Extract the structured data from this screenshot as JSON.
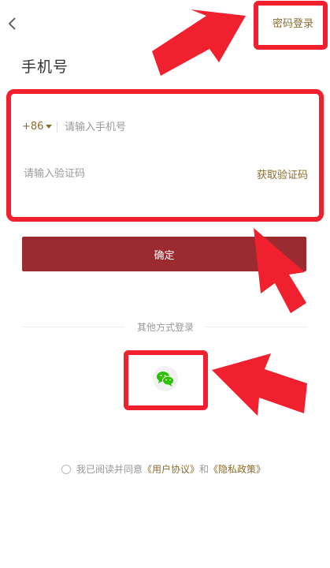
{
  "header": {
    "back_icon": "chevron-left-icon",
    "password_login_label": "密码登录"
  },
  "page_title": "手机号",
  "form": {
    "country_code": "+86",
    "phone_placeholder": "请输入手机号",
    "code_placeholder": "请输入验证码",
    "get_code_label": "获取验证码"
  },
  "confirm_label": "确定",
  "other_login": {
    "label": "其他方式登录",
    "wechat_icon": "wechat-icon"
  },
  "agreement": {
    "prefix": "我已阅读并同意",
    "user_agreement": "《用户协议》",
    "and": "和",
    "privacy_policy": "《隐私政策》"
  },
  "colors": {
    "accent": "#8a6d2f",
    "confirm_button": "#9b2b2f",
    "annotation": "#f0202e",
    "wechat": "#2dc100"
  }
}
